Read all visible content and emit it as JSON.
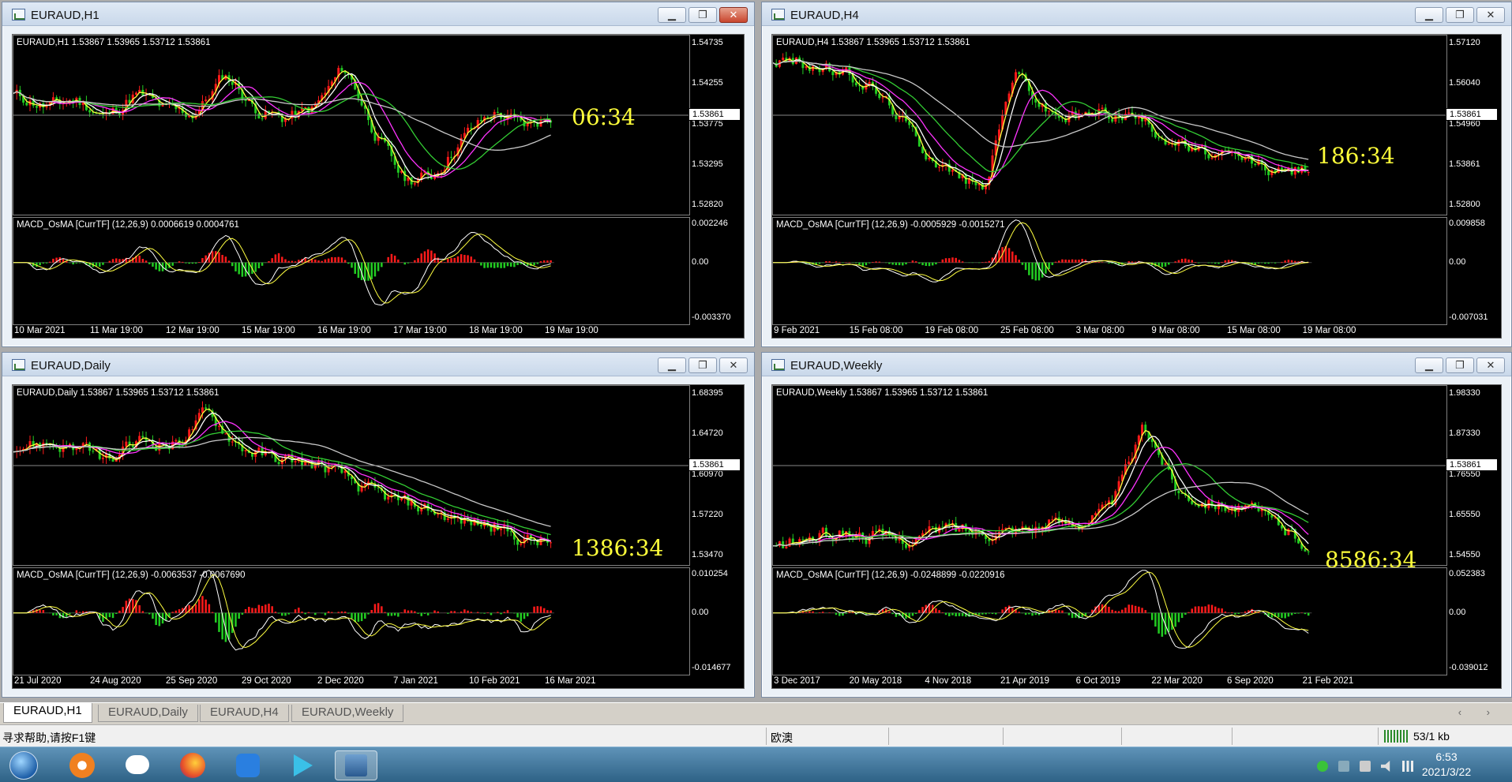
{
  "colors": {
    "bull": "#ff1a1a",
    "bear": "#22cc22",
    "ma_fast": "#ffff40",
    "ma_white": "#ffffff",
    "ma_mag": "#ff33ff",
    "ma_green": "#33cc33",
    "ma_gray": "#c8c8c8",
    "countdown": "#ffff3a"
  },
  "windows": [
    {
      "title": "EURAUD,H1",
      "price_label": "EURAUD,H1  1.53867 1.53965 1.53712 1.53861",
      "price_ticks": [
        "1.54735",
        "1.54255",
        "1.53775",
        "1.53295",
        "1.52820"
      ],
      "current_price": "1.53861",
      "countdown": "06:34",
      "macd_label": "MACD_OsMA [CurrTF] (12,26,9) 0.0006619 0.0004761",
      "macd_ticks": [
        "0.002246",
        "0.00",
        "-0.003370"
      ],
      "time_labels": [
        "10 Mar 2021",
        "11 Mar 19:00",
        "12 Mar 19:00",
        "15 Mar 19:00",
        "16 Mar 19:00",
        "17 Mar 19:00",
        "18 Mar 19:00",
        "19 Mar 19:00"
      ]
    },
    {
      "title": "EURAUD,H4",
      "price_label": "EURAUD,H4  1.53867 1.53965 1.53712 1.53861",
      "price_ticks": [
        "1.57120",
        "1.56040",
        "1.54960",
        "1.53861",
        "1.52800"
      ],
      "current_price": "1.53861",
      "countdown": "186:34",
      "macd_label": "MACD_OsMA [CurrTF] (12,26,9) -0.0005929 -0.0015271",
      "macd_ticks": [
        "0.009858",
        "0.00",
        "-0.007031"
      ],
      "time_labels": [
        "9 Feb 2021",
        "15 Feb 08:00",
        "19 Feb 08:00",
        "25 Feb 08:00",
        "3 Mar 08:00",
        "9 Mar 08:00",
        "15 Mar 08:00",
        "19 Mar 08:00"
      ]
    },
    {
      "title": "EURAUD,Daily",
      "price_label": "EURAUD,Daily  1.53867 1.53965 1.53712 1.53861",
      "price_ticks": [
        "1.68395",
        "1.64720",
        "1.60970",
        "1.57220",
        "1.53470"
      ],
      "current_price": "1.53861",
      "countdown": "1386:34",
      "macd_label": "MACD_OsMA [CurrTF] (12,26,9) -0.0063537 -0.0067690",
      "macd_ticks": [
        "0.010254",
        "0.00",
        "-0.014677"
      ],
      "time_labels": [
        "21 Jul 2020",
        "24 Aug 2020",
        "25 Sep 2020",
        "29 Oct 2020",
        "2 Dec 2020",
        "7 Jan 2021",
        "10 Feb 2021",
        "16 Mar 2021"
      ]
    },
    {
      "title": "EURAUD,Weekly",
      "price_label": "EURAUD,Weekly  1.53867 1.53965 1.53712 1.53861",
      "price_ticks": [
        "1.98330",
        "1.87330",
        "1.76550",
        "1.65550",
        "1.54550"
      ],
      "current_price": "1.53861",
      "countdown": "8586:34",
      "macd_label": "MACD_OsMA [CurrTF] (12,26,9) -0.0248899 -0.0220916",
      "macd_ticks": [
        "0.052383",
        "0.00",
        "-0.039012"
      ],
      "time_labels": [
        "3 Dec 2017",
        "20 May 2018",
        "4 Nov 2018",
        "21 Apr 2019",
        "6 Oct 2019",
        "22 Mar 2020",
        "6 Sep 2020",
        "21 Feb 2021"
      ]
    }
  ],
  "tabs": [
    "EURAUD,H1",
    "EURAUD,Daily",
    "EURAUD,H4",
    "EURAUD,Weekly"
  ],
  "tab_arrows": "‹ ›",
  "status": {
    "help": "寻求帮助,请按F1键",
    "profile": "欧澳",
    "traffic": "53/1 kb"
  },
  "taskbar": {
    "apps": [
      "start-orb-icon",
      "taskbar-app-orange-icon",
      "wechat-icon",
      "firefox-icon",
      "taskbar-app-blue-icon",
      "media-player-icon",
      "trading-terminal-icon"
    ],
    "time": "6:53",
    "date": "2021/3/22"
  }
}
